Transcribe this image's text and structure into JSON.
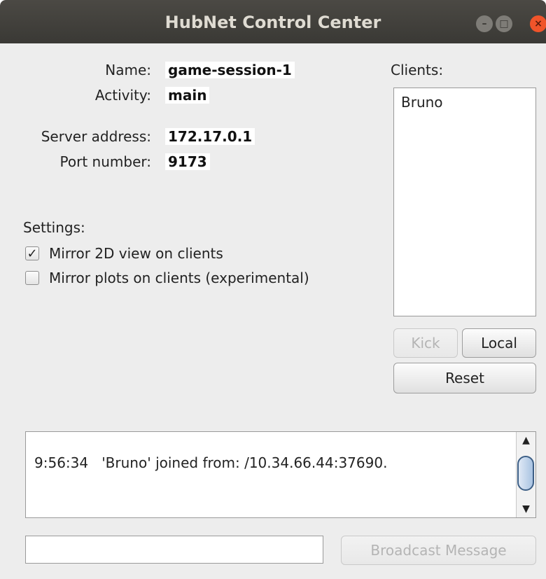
{
  "window": {
    "title": "HubNet Control Center",
    "controls": [
      "minimize-icon",
      "maximize-icon",
      "close-icon"
    ]
  },
  "session": {
    "name_label": "Name:",
    "name_value": "game-session-1",
    "activity_label": "Activity:",
    "activity_value": "main",
    "server_label": "Server address:",
    "server_value": "172.17.0.1",
    "port_label": "Port number:",
    "port_value": "9173"
  },
  "settings": {
    "heading": "Settings:",
    "options": [
      {
        "label": "Mirror 2D view on clients",
        "checked": true
      },
      {
        "label": "Mirror plots on clients (experimental)",
        "checked": false
      }
    ]
  },
  "clients": {
    "heading": "Clients:",
    "items": [
      "Bruno"
    ],
    "kick_label": "Kick",
    "local_label": "Local",
    "reset_label": "Reset"
  },
  "log": {
    "entries": [
      {
        "time": "9:56:34",
        "text": "'Bruno' joined from: /10.34.66.44:37690."
      }
    ]
  },
  "broadcast": {
    "input_value": "",
    "button_label": "Broadcast Message"
  },
  "colors": {
    "titlebar": "#3f3e3a",
    "close_button": "#f0542a",
    "window_bg": "#ededed"
  }
}
